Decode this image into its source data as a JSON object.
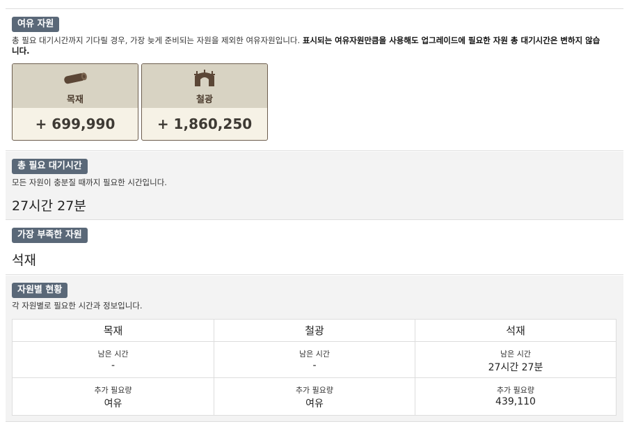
{
  "surplus": {
    "badge": "여유 자원",
    "desc_normal": "총 필요 대기시간까지 기다릴 경우, 가장 늦게 준비되는 자원을 제외한 여유자원입니다. ",
    "desc_bold": "표시되는 여유자원만큼을 사용해도 업그레이드에 필요한 자원 총 대기시간은 변하지 않습니다.",
    "resources": [
      {
        "name": "목재",
        "value": "+ 699,990",
        "icon": "wood-log-icon"
      },
      {
        "name": "철광",
        "value": "+ 1,860,250",
        "icon": "iron-mine-icon"
      }
    ]
  },
  "total_wait": {
    "badge": "총 필요 대기시간",
    "desc": "모든 자원이 충분질 때까지 필요한 시간입니다.",
    "value": "27시간 27분"
  },
  "shortest": {
    "badge": "가장 부족한 자원",
    "value": "석재"
  },
  "status": {
    "badge": "자원별 현황",
    "desc": "각 자원별로 필요한 시간과 정보입니다.",
    "columns": [
      {
        "name": "목재",
        "remain_label": "남은 시간",
        "remain_value": "-",
        "extra_label": "추가 필요량",
        "extra_value": "여유"
      },
      {
        "name": "철광",
        "remain_label": "남은 시간",
        "remain_value": "-",
        "extra_label": "추가 필요량",
        "extra_value": "여유"
      },
      {
        "name": "석재",
        "remain_label": "남은 시간",
        "remain_value": "27시간 27분",
        "extra_label": "추가 필요량",
        "extra_value": "439,110"
      }
    ]
  },
  "colors": {
    "badge_bg": "#5a6878",
    "card_top": "#d8d3c3",
    "card_bottom": "#f6f2e6",
    "card_border": "#6b5c4c",
    "icon": "#5b4636"
  }
}
